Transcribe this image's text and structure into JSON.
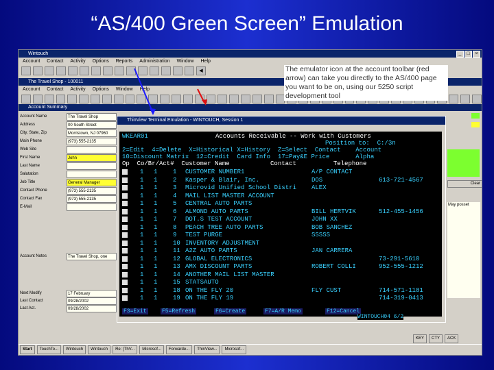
{
  "slide": {
    "title": "“AS/400 Green Screen” Emulation"
  },
  "note": "The emulator icon at the account toolbar (red arrow) can take you directly to the AS/400 page you want to be on, using our 5250 script development tool",
  "outer_window": {
    "title": "Wintouch",
    "menu": [
      "Account",
      "Contact",
      "Activity",
      "Options",
      "Reports",
      "Administration",
      "Window",
      "Help"
    ],
    "inner_title": "The Travel Shop - 100011",
    "inner_menu": [
      "Account",
      "Contact",
      "Activity",
      "Options",
      "Window",
      "Help"
    ],
    "section": "Account Summary",
    "fields": [
      {
        "label": "Account Name",
        "value": "The Travel Shop"
      },
      {
        "label": "Address",
        "value": "00 South Street"
      },
      {
        "label": "City, State, Zip",
        "value": "Morristown, NJ 07960"
      },
      {
        "label": "Main Phone",
        "value": "(973) 555-2135"
      },
      {
        "label": "Web Site",
        "value": ""
      },
      {
        "label": "First Name",
        "value": "John"
      },
      {
        "label": "Last Name",
        "value": ""
      },
      {
        "label": "Salutation",
        "value": ""
      },
      {
        "label": "Job Title",
        "value": "General Manager"
      },
      {
        "label": "Contact Phone",
        "value": "(973) 555-2135"
      },
      {
        "label": "Contact Fax",
        "value": "(973) 555-2135"
      },
      {
        "label": "E-Mail",
        "value": ""
      },
      {
        "label": "Account Notes",
        "value": "The Travel Shop, one"
      }
    ],
    "last_fields": [
      {
        "label": "Next Modify",
        "value": "17 February"
      },
      {
        "label": "Last Contact",
        "value": "09/28/2002"
      },
      {
        "label": "Last Act.",
        "value": "09/28/2002"
      }
    ],
    "right_buttons": [
      "Clear"
    ],
    "right_text": "May posset"
  },
  "terminal": {
    "title": "ThinView Terminal Emulation - WINTOUCH, Session 1",
    "header_id": "WKEAR01",
    "header_title": "Accounts Receivable -- Work with Customers",
    "position_to": "Position to:  C:/3n",
    "options": [
      "2=Edit  4=Delete  X=Historical X=History  Z=Select  Contact    Account",
      "10=Discount Matrix  12=Credit  Card Info  17=Pay&E Price       Alpha"
    ],
    "columns": "Op  Co/Br/Act#  Customer Name           Contact          Telephone",
    "rows": [
      {
        "co": "1",
        "br": "1",
        "act": "1",
        "name": "CUSTOMER NUMBER1",
        "contact": "A/P CONTACT",
        "phone": ""
      },
      {
        "co": "1",
        "br": "1",
        "act": "2",
        "name": "Kasper & Blair, Inc.",
        "contact": "DOS",
        "phone": "613-721-4567"
      },
      {
        "co": "1",
        "br": "1",
        "act": "3",
        "name": "Microvid Unified School Distri",
        "contact": "ALEX",
        "phone": ""
      },
      {
        "co": "1",
        "br": "1",
        "act": "4",
        "name": "MAIL LIST MASTER ACCOUNT",
        "contact": "",
        "phone": ""
      },
      {
        "co": "1",
        "br": "1",
        "act": "5",
        "name": "CENTRAL AUTO PARTS",
        "contact": "",
        "phone": ""
      },
      {
        "co": "1",
        "br": "1",
        "act": "6",
        "name": "ALMOND AUTO PARTS",
        "contact": "BILL HERTVIK",
        "phone": "512-455-1456"
      },
      {
        "co": "1",
        "br": "1",
        "act": "7",
        "name": "DOT.S TEST ACCOUNT",
        "contact": "JOHN XX",
        "phone": ""
      },
      {
        "co": "1",
        "br": "1",
        "act": "8",
        "name": "PEACH TREE AUTO PARTS",
        "contact": "BOB SANCHEZ",
        "phone": ""
      },
      {
        "co": "1",
        "br": "1",
        "act": "9",
        "name": "TEST PURGE",
        "contact": "SSSSS",
        "phone": ""
      },
      {
        "co": "1",
        "br": "1",
        "act": "10",
        "name": "INVENTORY ADJUSTMENT",
        "contact": "",
        "phone": ""
      },
      {
        "co": "1",
        "br": "1",
        "act": "11",
        "name": "A2Z AUTO PARTS",
        "contact": "JAN CARRERA",
        "phone": ""
      },
      {
        "co": "1",
        "br": "1",
        "act": "12",
        "name": "GLOBAL ELECTRONICS",
        "contact": "",
        "phone": "73-291-5610"
      },
      {
        "co": "1",
        "br": "1",
        "act": "13",
        "name": "AMX DISCOUNT PARTS",
        "contact": "ROBERT COLLI",
        "phone": "952-555-1212"
      },
      {
        "co": "1",
        "br": "1",
        "act": "14",
        "name": "ANOTHER MAIL LIST MASTER",
        "contact": "",
        "phone": ""
      },
      {
        "co": "1",
        "br": "1",
        "act": "15",
        "name": "STATSAUTO",
        "contact": "",
        "phone": ""
      },
      {
        "co": "1",
        "br": "1",
        "act": "18",
        "name": "ON THE FLY 20",
        "contact": "FLY CUST",
        "phone": "714-571-1181"
      },
      {
        "co": "1",
        "br": "1",
        "act": "19",
        "name": "ON THE FLY 19",
        "contact": "",
        "phone": "714-319-0413"
      }
    ],
    "fkeys": [
      "F3=Exit",
      "F5=Refresh",
      "F6=Create",
      "F7=A/R Memo",
      "F12=Cancel"
    ],
    "status": "WINTOUCH04     6/2"
  },
  "taskbar": [
    "Start",
    "TouchTo...",
    "Wintouch",
    "Wintouch",
    "Re: [ThV...",
    "Microsof...",
    "Forwarde...",
    "ThinView...",
    "Microsof..."
  ],
  "bottom_right": [
    "KEY",
    "CTY",
    "ACK"
  ]
}
